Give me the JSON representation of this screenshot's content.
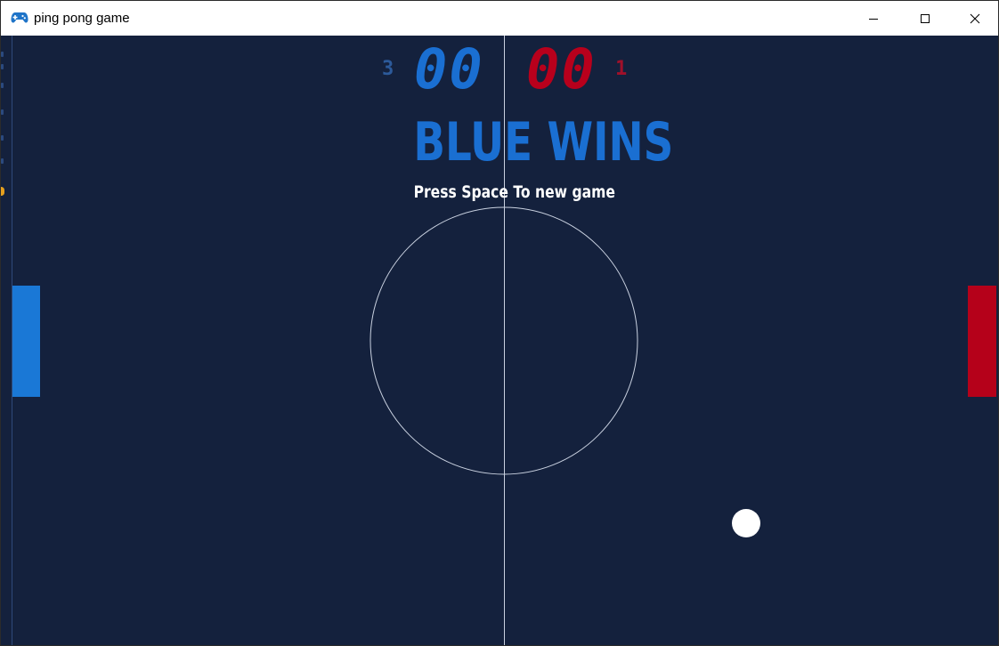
{
  "window": {
    "title": "ping pong game",
    "app_icon": "gamepad-icon",
    "controls": {
      "minimize_icon": "minimize-icon",
      "maximize_icon": "maximize-icon",
      "close_icon": "close-icon"
    }
  },
  "game": {
    "blue": {
      "rounds_won": "3",
      "score": "00",
      "color": "#1a6fd2",
      "paddle_color": "#1a78d6"
    },
    "red": {
      "rounds_won": "1",
      "score": "00",
      "color": "#b8001c",
      "paddle_color": "#b5011a"
    },
    "winner_text": "BLUE WINS",
    "prompt_text": "Press Space To new game",
    "background_color": "#14213d",
    "line_color": "#c9d1e0",
    "ball_color": "#ffffff"
  }
}
